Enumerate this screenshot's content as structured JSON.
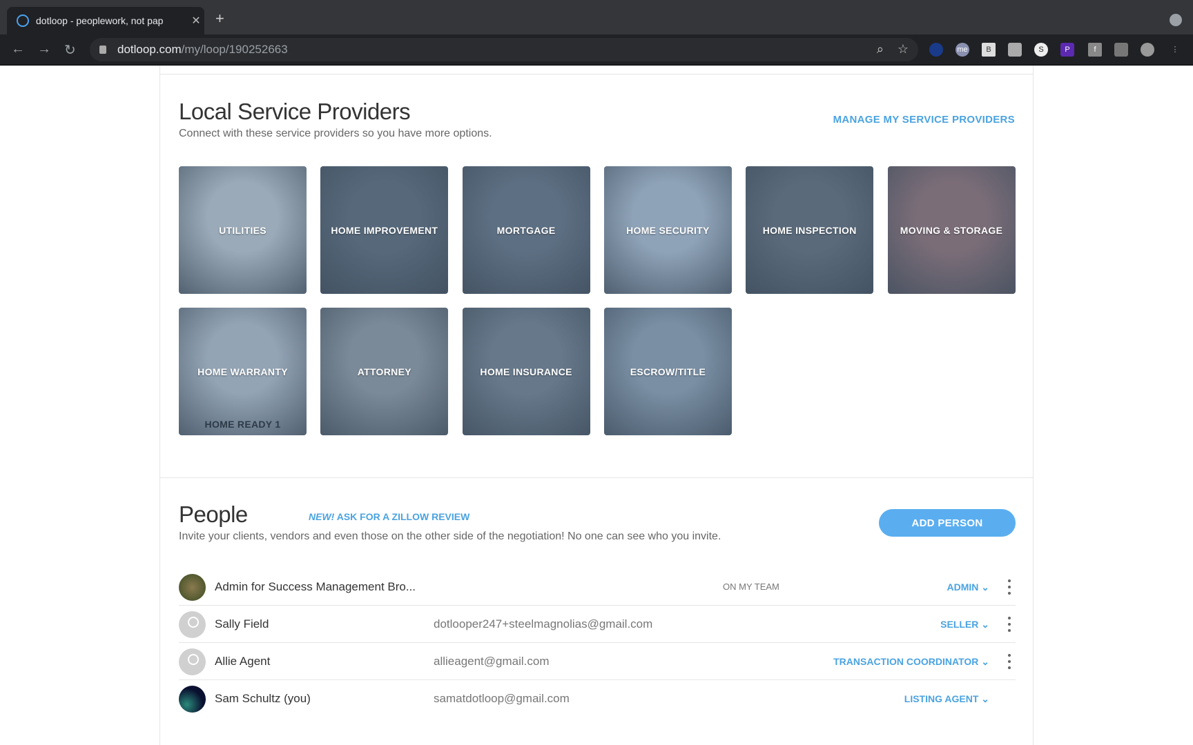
{
  "browser": {
    "tab_title": "dotloop - peoplework, not pap",
    "url_domain": "dotloop.com",
    "url_path": "/my/loop/190252663"
  },
  "providers": {
    "title": "Local Service Providers",
    "subtitle": "Connect with these service providers so you have more options.",
    "manage_link": "MANAGE MY SERVICE PROVIDERS",
    "tiles": [
      {
        "label": "UTILITIES",
        "color": "#9aaab8"
      },
      {
        "label": "HOME IMPROVEMENT",
        "color": "#56687a"
      },
      {
        "label": "MORTGAGE",
        "color": "#5d6f82"
      },
      {
        "label": "HOME SECURITY",
        "color": "#8fa3b8"
      },
      {
        "label": "HOME INSPECTION",
        "color": "#5a6a7a"
      },
      {
        "label": "MOVING & STORAGE",
        "color": "#7a6d78"
      },
      {
        "label": "HOME WARRANTY",
        "color": "#93a4b5",
        "logo_text": "HOME READY 1"
      },
      {
        "label": "ATTORNEY",
        "color": "#7b8a98"
      },
      {
        "label": "HOME INSURANCE",
        "color": "#66788a"
      },
      {
        "label": "ESCROW/TITLE",
        "color": "#7a8fa4"
      }
    ]
  },
  "people": {
    "title": "People",
    "zillow_new": "NEW!",
    "zillow_link": "ASK FOR A ZILLOW REVIEW",
    "subtitle": "Invite your clients, vendors and even those on the other side of the negotiation! No one can see who you invite.",
    "add_button": "ADD PERSON",
    "rows": [
      {
        "name": "Admin for Success Management Bro...",
        "email": "",
        "team": "ON MY TEAM",
        "role": "ADMIN"
      },
      {
        "name": "Sally Field",
        "email": "dotlooper247+steelmagnolias@gmail.com",
        "team": "",
        "role": "SELLER"
      },
      {
        "name": "Allie Agent",
        "email": "allieagent@gmail.com",
        "team": "",
        "role": "TRANSACTION COORDINATOR"
      },
      {
        "name": "Sam Schultz (you)",
        "email": "samatdotloop@gmail.com",
        "team": "",
        "role": "LISTING AGENT"
      }
    ]
  },
  "colors": {
    "accent": "#4aa3e0",
    "button": "#5aaef0"
  }
}
